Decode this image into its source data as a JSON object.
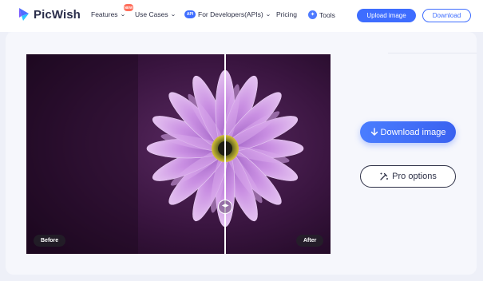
{
  "brand": {
    "name": "PicWish"
  },
  "nav": {
    "features": "Features",
    "new_badge": "NEW",
    "use_cases": "Use Cases",
    "api_badge": "API",
    "developers": "For Developers(APIs)",
    "pricing": "Pricing",
    "tools": "Tools",
    "upload": "Upload image",
    "download": "Download"
  },
  "compare": {
    "before": "Before",
    "after": "After",
    "handle_icon": "left-right-arrows-icon"
  },
  "actions": {
    "download_image": "Download image",
    "pro_options": "Pro options"
  },
  "colors": {
    "accent": "#3e6dff",
    "text": "#2e3147",
    "petal": "#c88fe0",
    "background": "#2a0f2e"
  }
}
